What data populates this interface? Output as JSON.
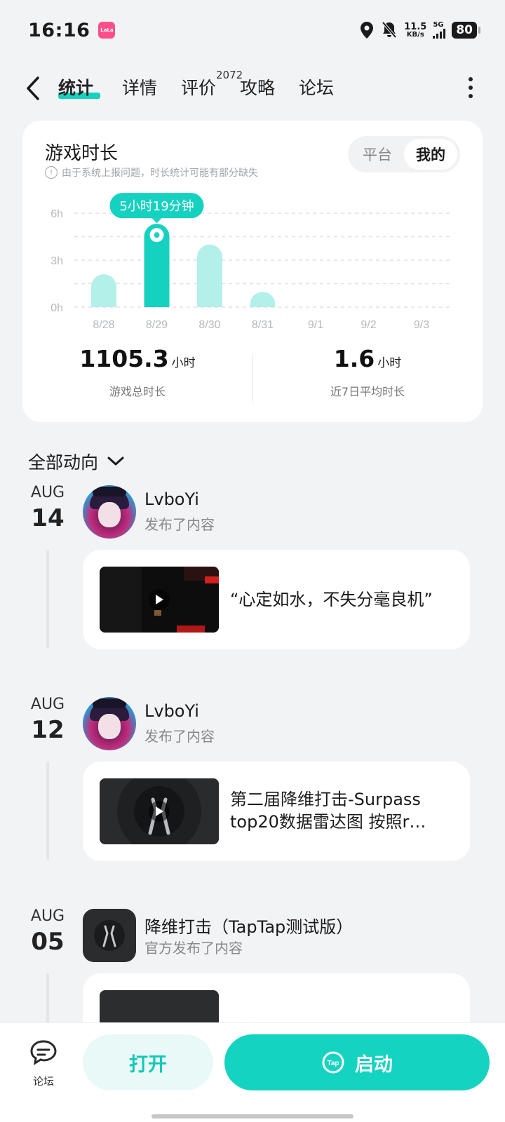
{
  "status_bar": {
    "time": "16:16",
    "app_badge": "LaLa",
    "net_speed_value": "11.5",
    "net_speed_unit": "KB/s",
    "signal_label": "5G",
    "battery": "80"
  },
  "nav": {
    "tabs": [
      {
        "label": "统计",
        "active": true
      },
      {
        "label": "详情",
        "active": false
      },
      {
        "label": "评价",
        "active": false
      },
      {
        "label": "攻略",
        "active": false
      },
      {
        "label": "论坛",
        "active": false
      }
    ],
    "review_count": "2072"
  },
  "playtime_card": {
    "title": "游戏时长",
    "note": "由于系统上报问题，时长统计可能有部分缺失",
    "segment_options": [
      "平台",
      "我的"
    ],
    "segment_selected": "我的",
    "total_value": "1105.3",
    "total_unit": "小时",
    "total_label": "游戏总时长",
    "avg_value": "1.6",
    "avg_unit": "小时",
    "avg_label": "近7日平均时长"
  },
  "chart_data": {
    "type": "bar",
    "categories": [
      "8/28",
      "8/29",
      "8/30",
      "8/31",
      "9/1",
      "9/2",
      "9/3"
    ],
    "values": [
      2.1,
      5.32,
      4.0,
      0.35,
      0,
      0,
      0
    ],
    "y_ticks": [
      "0h",
      "3h",
      "6h"
    ],
    "ylim": [
      0,
      6
    ],
    "highlight_index": 1,
    "highlight_label": "5小时19分钟",
    "grid": true,
    "colors": {
      "bar": "#b3f0ea",
      "highlight": "#15d1c0",
      "grid": "#dfe1e4"
    }
  },
  "feed": {
    "filter_label": "全部动向",
    "entries": [
      {
        "month": "AUG",
        "day": "14",
        "author": "LvboYi",
        "action": "发布了内容",
        "post_text": "“心定如水，不失分毫良机”"
      },
      {
        "month": "AUG",
        "day": "12",
        "author": "LvboYi",
        "action": "发布了内容",
        "post_text": "第二届降维打击-Surpass top20数据雷达图 按照r…"
      },
      {
        "month": "AUG",
        "day": "05",
        "author": "降维打击（TapTap测试版）",
        "action": "官方发布了内容"
      }
    ]
  },
  "bottom_bar": {
    "forum_label": "论坛",
    "open_label": "打开",
    "launch_label": "启动",
    "accent": "#14d3c0"
  }
}
